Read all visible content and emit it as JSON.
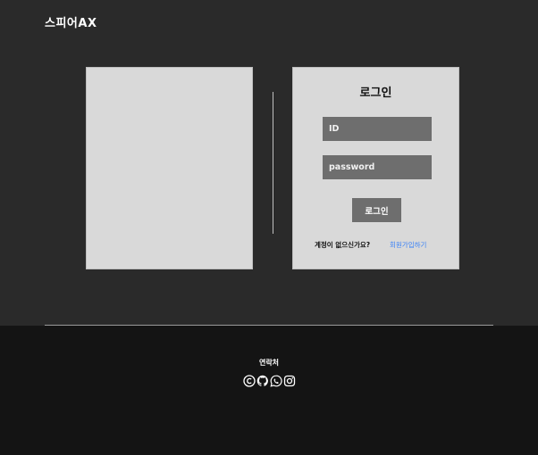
{
  "header": {
    "logo": "스피어AX"
  },
  "login": {
    "title": "로그인",
    "id_placeholder": "ID",
    "password_placeholder": "password",
    "button_label": "로그인",
    "signup_prompt": "계정이 없으신가요?",
    "signup_link": "회원가입하기"
  },
  "footer": {
    "title": "연락처",
    "social_icons": [
      "copyright-icon",
      "github-icon",
      "whatsapp-icon",
      "instagram-icon"
    ]
  },
  "colors": {
    "background": "#2a2a2a",
    "footer_background": "#141414",
    "panel": "#d9d9d9",
    "input": "#6e6e6e",
    "link": "#3b82f6"
  }
}
